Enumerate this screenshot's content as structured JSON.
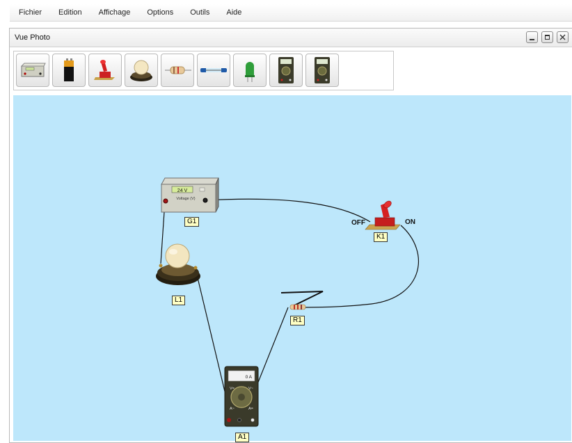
{
  "menu": [
    "Fichier",
    "Edition",
    "Affichage",
    "Options",
    "Outils",
    "Aide"
  ],
  "panel": {
    "title": "Vue Photo"
  },
  "toolbar": {
    "tools": [
      "generator-icon",
      "battery-icon",
      "switch-icon",
      "lamp-icon",
      "resistor-icon",
      "fuse-icon",
      "led-icon",
      "voltmeter-icon",
      "ammeter-icon"
    ]
  },
  "circuit": {
    "generator": {
      "label": "G1",
      "display": "24 V",
      "caption": "Voltage (V)"
    },
    "switch": {
      "label": "K1",
      "off_text": "OFF",
      "on_text": "ON"
    },
    "lamp": {
      "label": "L1"
    },
    "resistor": {
      "label": "R1"
    },
    "ammeter": {
      "label": "A1",
      "display": "0 A",
      "ranges": [
        "V=",
        "V~",
        "A~",
        "A="
      ]
    }
  },
  "colors": {
    "canvas": "#bde7fb",
    "label_bg": "#ffffc4",
    "wire": "#111111"
  }
}
